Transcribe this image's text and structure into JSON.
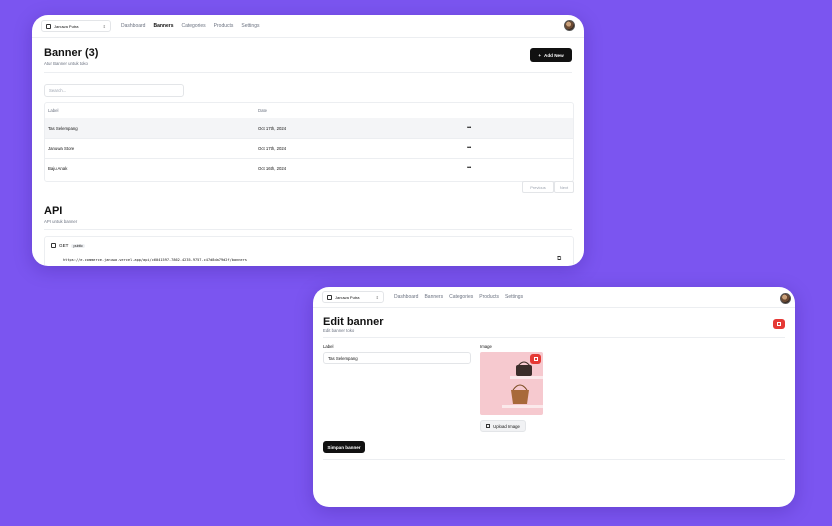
{
  "store": {
    "name": "Januwa Putra"
  },
  "nav": {
    "dashboard": "Dashboard",
    "banners": "Banners",
    "categories": "Categories",
    "products": "Products",
    "settings": "Settings"
  },
  "list_page": {
    "title": "Banner (3)",
    "subtitle": "Atur Banner untuk toko",
    "add_button": "Add New",
    "search_placeholder": "Search...",
    "columns": {
      "label": "Label",
      "date": "Date"
    },
    "rows": [
      {
        "label": "Tas Selempang",
        "date": "Oct 17th, 2024",
        "actions": "•••"
      },
      {
        "label": "Januwa Store",
        "date": "Oct 17th, 2024",
        "actions": "•••"
      },
      {
        "label": "Baju Anak",
        "date": "Oct 16th, 2024",
        "actions": "•••"
      }
    ],
    "pagination": {
      "previous": "Previous",
      "next": "Next"
    },
    "api": {
      "title": "API",
      "subtitle": "API untuk banner",
      "method": "GET",
      "access": "public",
      "url": "https://e-commerce-januwa.vercel.app/api/c6041597-7862-4235-9757-c47d8da79d2f/banners"
    }
  },
  "edit_page": {
    "title": "Edit banner",
    "subtitle": "Edit banner toko",
    "label_field": {
      "label": "Label",
      "value": "Tas Selempang"
    },
    "image_field": {
      "label": "Image"
    },
    "upload_button": "Upload Image",
    "save_button": "Simpan banner"
  },
  "colors": {
    "background": "#7b55f0",
    "primary": "#111111",
    "danger": "#e53935"
  }
}
